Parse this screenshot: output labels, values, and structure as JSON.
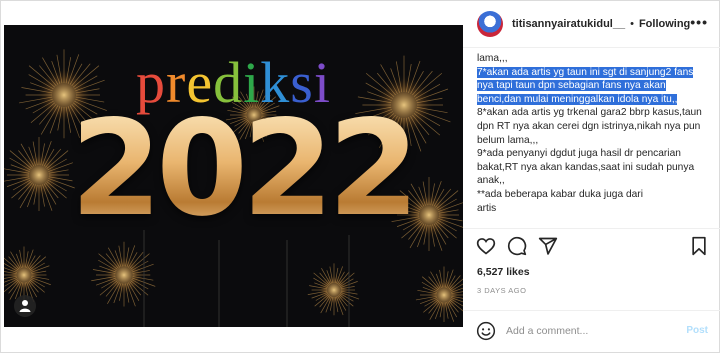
{
  "post": {
    "image": {
      "title_letters": [
        {
          "char": "p",
          "color": "#e64b3c"
        },
        {
          "char": "r",
          "color": "#f08a2c"
        },
        {
          "char": "e",
          "color": "#f4c431"
        },
        {
          "char": "d",
          "color": "#86c03c"
        },
        {
          "char": "i",
          "color": "#2ea84a"
        },
        {
          "char": "k",
          "color": "#2f8fd6"
        },
        {
          "char": "s",
          "color": "#3a5fd0"
        },
        {
          "char": "i",
          "color": "#7d4cc9"
        }
      ],
      "year": "2022",
      "tag_icon": "person-tag-icon"
    },
    "header": {
      "username": "titisannyairatukidul__",
      "separator": "•",
      "follow_label": "Following",
      "more_icon": "more-options-icon"
    },
    "caption": {
      "lines": [
        {
          "text": "lama,,,",
          "highlight": false
        },
        {
          "text": "7*akan ada artis yg taun ini sgt di sanjung2 fans nya tapi taun dpn sebagian fans nya akan benci,dan mulai meninggalkan idola nya itu,,",
          "highlight": true
        },
        {
          "text": "8*akan ada artis yg trkenal gara2 bbrp kasus,taun dpn RT nya akan cerei dgn istrinya,nikah nya pun belum lama,,,",
          "highlight": false
        },
        {
          "text": "9*ada penyanyi dgdut juga hasil dr pencarian bakat,RT nya akan kandas,saat ini sudah punya anak,,",
          "highlight": false
        },
        {
          "text": "**ada beberapa kabar duka juga dari",
          "highlight": false
        },
        {
          "text": "artis",
          "highlight": false
        }
      ]
    },
    "actions": {
      "like_icon": "heart-icon",
      "comment_icon": "comment-icon",
      "share_icon": "share-icon",
      "save_icon": "bookmark-icon"
    },
    "likes": "6,527 likes",
    "date": "3 DAYS AGO",
    "comment": {
      "emoji_icon": "emoji-icon",
      "placeholder": "Add a comment...",
      "post_label": "Post"
    },
    "colors": {
      "highlight": "#2f6fda",
      "post_disabled": "#b2dffc",
      "gold": "#e9b56f"
    }
  }
}
